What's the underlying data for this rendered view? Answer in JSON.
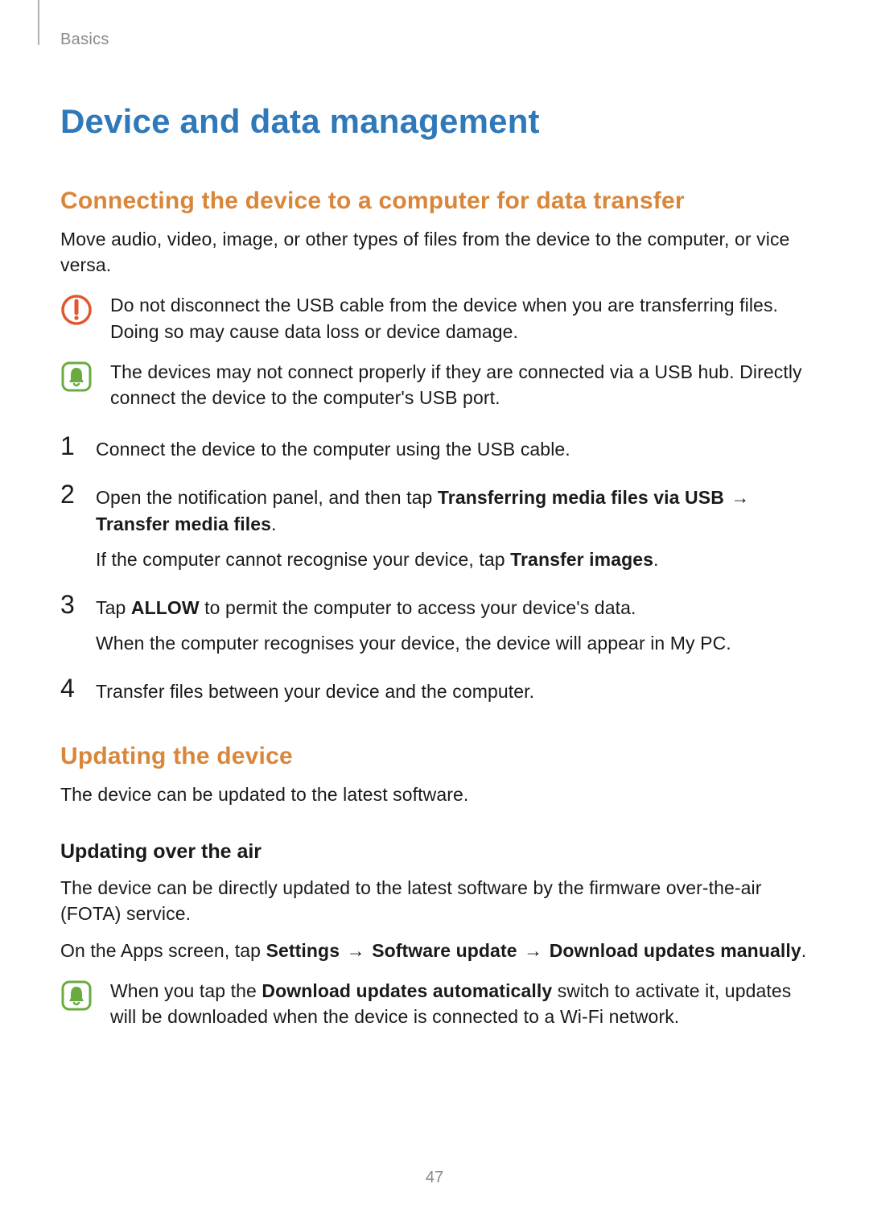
{
  "breadcrumb": "Basics",
  "title": "Device and data management",
  "section1": {
    "heading": "Connecting the device to a computer for data transfer",
    "intro": "Move audio, video, image, or other types of files from the device to the computer, or vice versa.",
    "warning": "Do not disconnect the USB cable from the device when you are transferring files. Doing so may cause data loss or device damage.",
    "note": "The devices may not connect properly if they are connected via a USB hub. Directly connect the device to the computer's USB port.",
    "steps": [
      {
        "num": "1",
        "text": "Connect the device to the computer using the USB cable."
      },
      {
        "num": "2",
        "pre": "Open the notification panel, and then tap ",
        "bold1": "Transferring media files via USB",
        "arrow1": " → ",
        "bold2": "Transfer media files",
        "post": ".",
        "line2_pre": "If the computer cannot recognise your device, tap ",
        "line2_bold": "Transfer images",
        "line2_post": "."
      },
      {
        "num": "3",
        "pre": "Tap ",
        "bold1": "ALLOW",
        "post": " to permit the computer to access your device's data.",
        "line2": "When the computer recognises your device, the device will appear in My PC."
      },
      {
        "num": "4",
        "text": "Transfer files between your device and the computer."
      }
    ]
  },
  "section2": {
    "heading": "Updating the device",
    "intro": "The device can be updated to the latest software.",
    "sub1": {
      "heading": "Updating over the air",
      "p1": "The device can be directly updated to the latest software by the firmware over-the-air (FOTA) service.",
      "p2_pre": "On the Apps screen, tap ",
      "p2_b1": "Settings",
      "p2_a1": " → ",
      "p2_b2": "Software update",
      "p2_a2": " → ",
      "p2_b3": "Download updates manually",
      "p2_post": ".",
      "note_pre": "When you tap the ",
      "note_bold": "Download updates automatically",
      "note_post": " switch to activate it, updates will be downloaded when the device is connected to a Wi-Fi network."
    }
  },
  "page_number": "47"
}
